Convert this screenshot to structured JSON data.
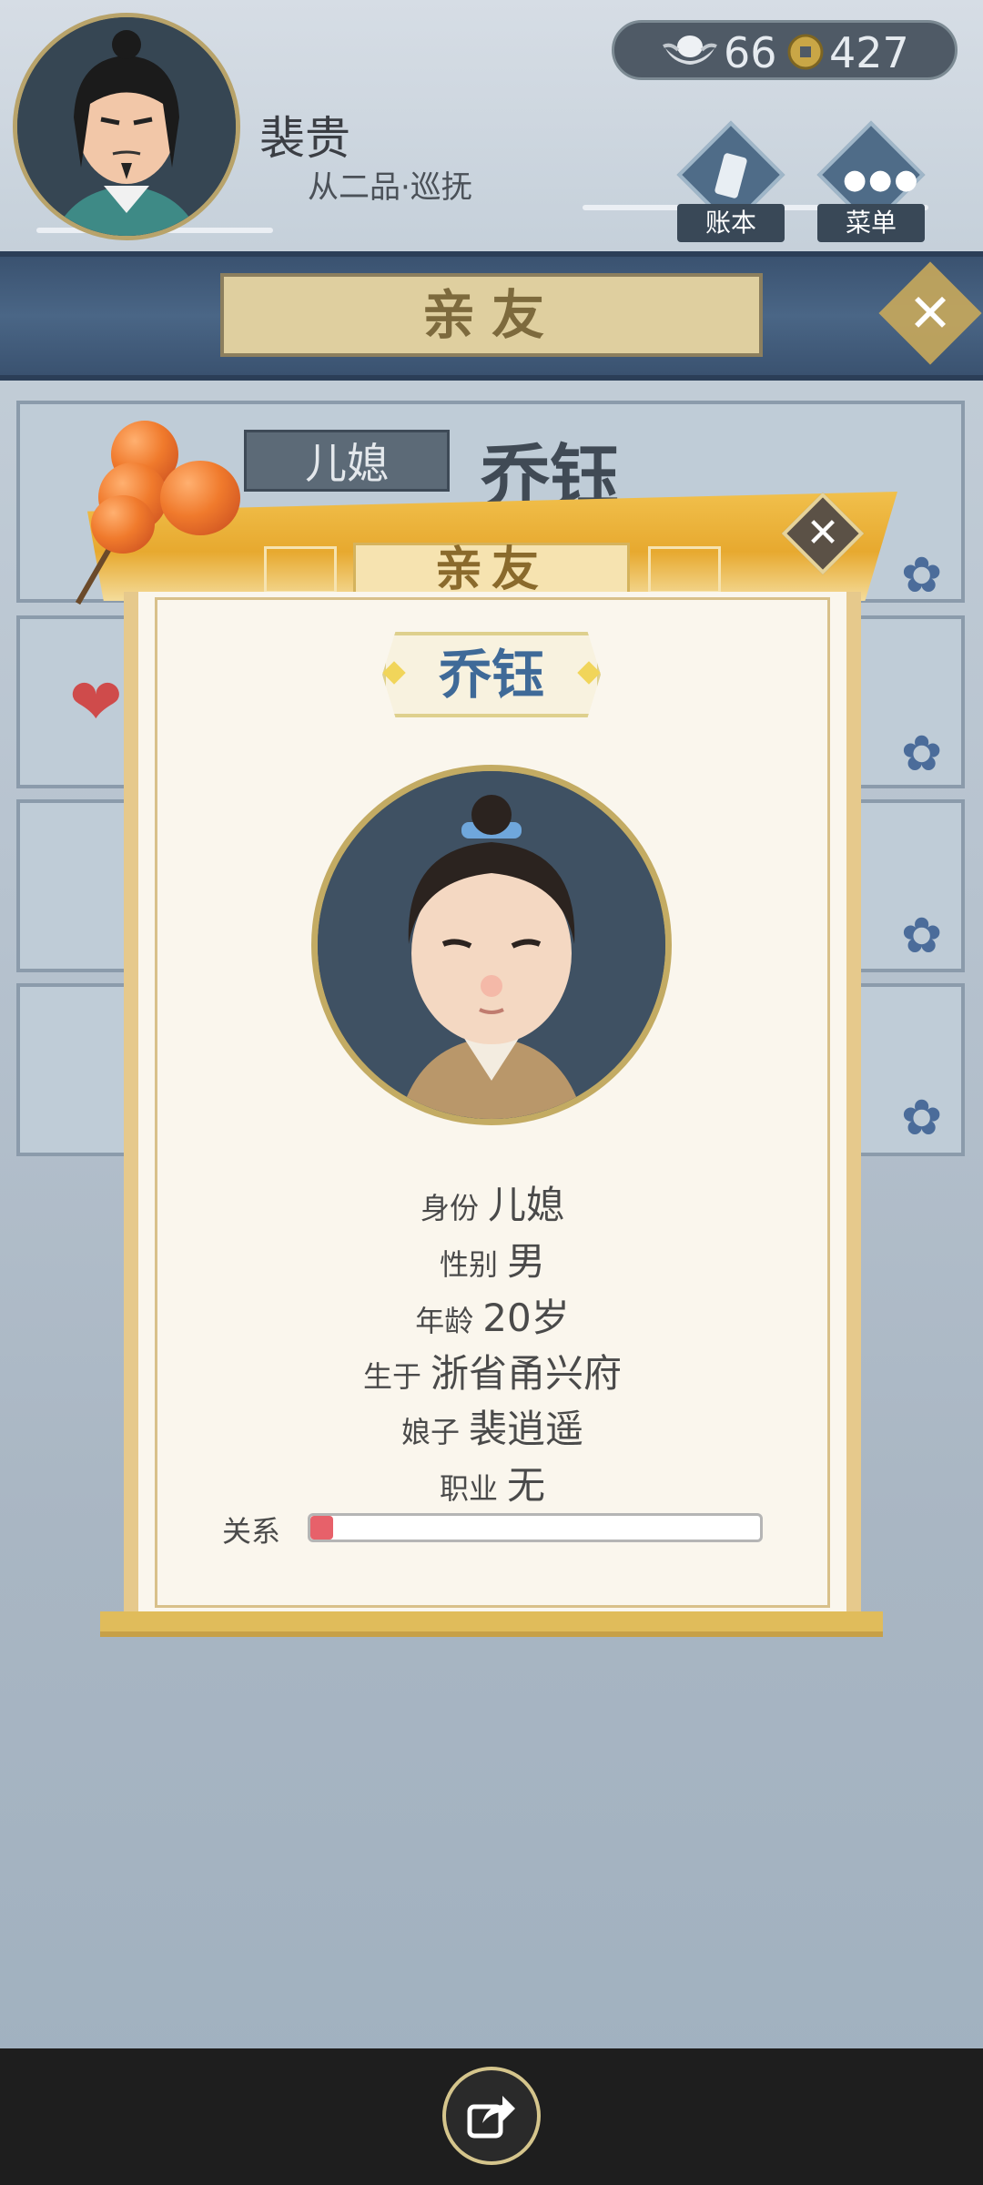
{
  "player": {
    "name": "裴贵",
    "rank": "从二品·巡抚"
  },
  "currency": {
    "silver": "66",
    "coins": "427",
    "silver_icon": "silver-ingot-icon",
    "coin_icon": "copper-coin-icon"
  },
  "nav": {
    "ledger_label": "账本",
    "menu_label": "菜单"
  },
  "page_title": "亲友",
  "selected_entry": {
    "role": "儿媳",
    "name": "乔钰"
  },
  "modal": {
    "title": "亲友",
    "name": "乔钰",
    "fields": [
      {
        "label": "身份",
        "value": "儿媳"
      },
      {
        "label": "性别",
        "value": "男"
      },
      {
        "label": "年龄",
        "value": "20岁"
      },
      {
        "label": "生于",
        "value": "浙省甬兴府"
      },
      {
        "label": "娘子",
        "value": "裴逍遥"
      },
      {
        "label": "职业",
        "value": "无"
      }
    ],
    "relationship_label": "关系",
    "relationship_level": 0.05
  },
  "colors": {
    "accent_gold": "#e7a92f",
    "name_blue": "#3f6a98",
    "relationship_red": "#e7616a",
    "band_blue": "#3a5270"
  }
}
